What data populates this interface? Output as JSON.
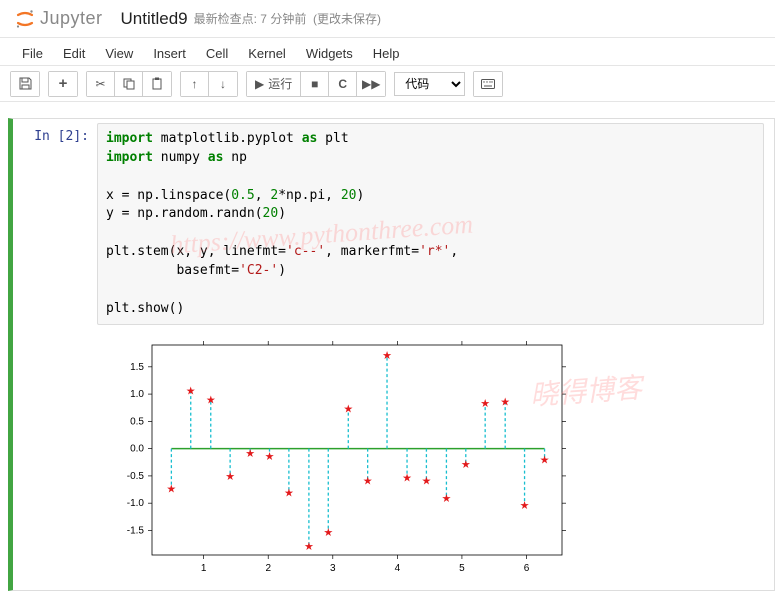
{
  "header": {
    "app_name": "Jupyter",
    "notebook_title": "Untitled9",
    "checkpoint": "最新检查点: 7 分钟前",
    "unsaved": "(更改未保存)"
  },
  "menubar": [
    "File",
    "Edit",
    "View",
    "Insert",
    "Cell",
    "Kernel",
    "Widgets",
    "Help"
  ],
  "toolbar": {
    "run_label": "运行",
    "cell_type": "代码"
  },
  "cell": {
    "prompt_prefix": "In [",
    "prompt_num": "2",
    "prompt_suffix": "]:",
    "code_tokens": [
      {
        "t": "import ",
        "c": "kw"
      },
      {
        "t": "matplotlib.pyplot "
      },
      {
        "t": "as ",
        "c": "kw"
      },
      {
        "t": "plt\n"
      },
      {
        "t": "import ",
        "c": "kw"
      },
      {
        "t": "numpy "
      },
      {
        "t": "as ",
        "c": "kw"
      },
      {
        "t": "np\n\n"
      },
      {
        "t": "x = np.linspace("
      },
      {
        "t": "0.5",
        "c": "num"
      },
      {
        "t": ", "
      },
      {
        "t": "2",
        "c": "num"
      },
      {
        "t": "*np.pi, "
      },
      {
        "t": "20",
        "c": "num"
      },
      {
        "t": ")\n"
      },
      {
        "t": "y = np.random.randn("
      },
      {
        "t": "20",
        "c": "num"
      },
      {
        "t": ")\n\n"
      },
      {
        "t": "plt.stem(x, y, linefmt="
      },
      {
        "t": "'c--'",
        "c": "str"
      },
      {
        "t": ", markerfmt="
      },
      {
        "t": "'r*'",
        "c": "str"
      },
      {
        "t": ",\n"
      },
      {
        "t": "         basefmt="
      },
      {
        "t": "'C2-'",
        "c": "str"
      },
      {
        "t": ")\n\n"
      },
      {
        "t": "plt.show()"
      }
    ]
  },
  "watermarks": {
    "url": "https://www.pythonthree.com",
    "blog": "晓得博客"
  },
  "chart_data": {
    "type": "stem",
    "x": [
      0.5,
      0.8,
      1.11,
      1.41,
      1.72,
      2.02,
      2.32,
      2.63,
      2.93,
      3.24,
      3.54,
      3.84,
      4.15,
      4.45,
      4.76,
      5.06,
      5.36,
      5.67,
      5.97,
      6.28
    ],
    "y": [
      -0.75,
      1.05,
      0.88,
      -0.52,
      -0.1,
      -0.15,
      -0.82,
      -1.8,
      -1.55,
      0.72,
      -0.6,
      1.7,
      -0.55,
      -0.6,
      -0.92,
      -0.3,
      0.82,
      0.85,
      -1.05,
      -0.22
    ],
    "baseline": 0.0,
    "linefmt": "c--",
    "markerfmt": "r*",
    "basefmt": "C2-",
    "xlim": [
      0.2,
      6.55
    ],
    "ylim": [
      -1.95,
      1.9
    ],
    "xticks": [
      1,
      2,
      3,
      4,
      5,
      6
    ],
    "yticks": [
      -1.5,
      -1.0,
      -0.5,
      0.0,
      0.5,
      1.0,
      1.5
    ]
  }
}
